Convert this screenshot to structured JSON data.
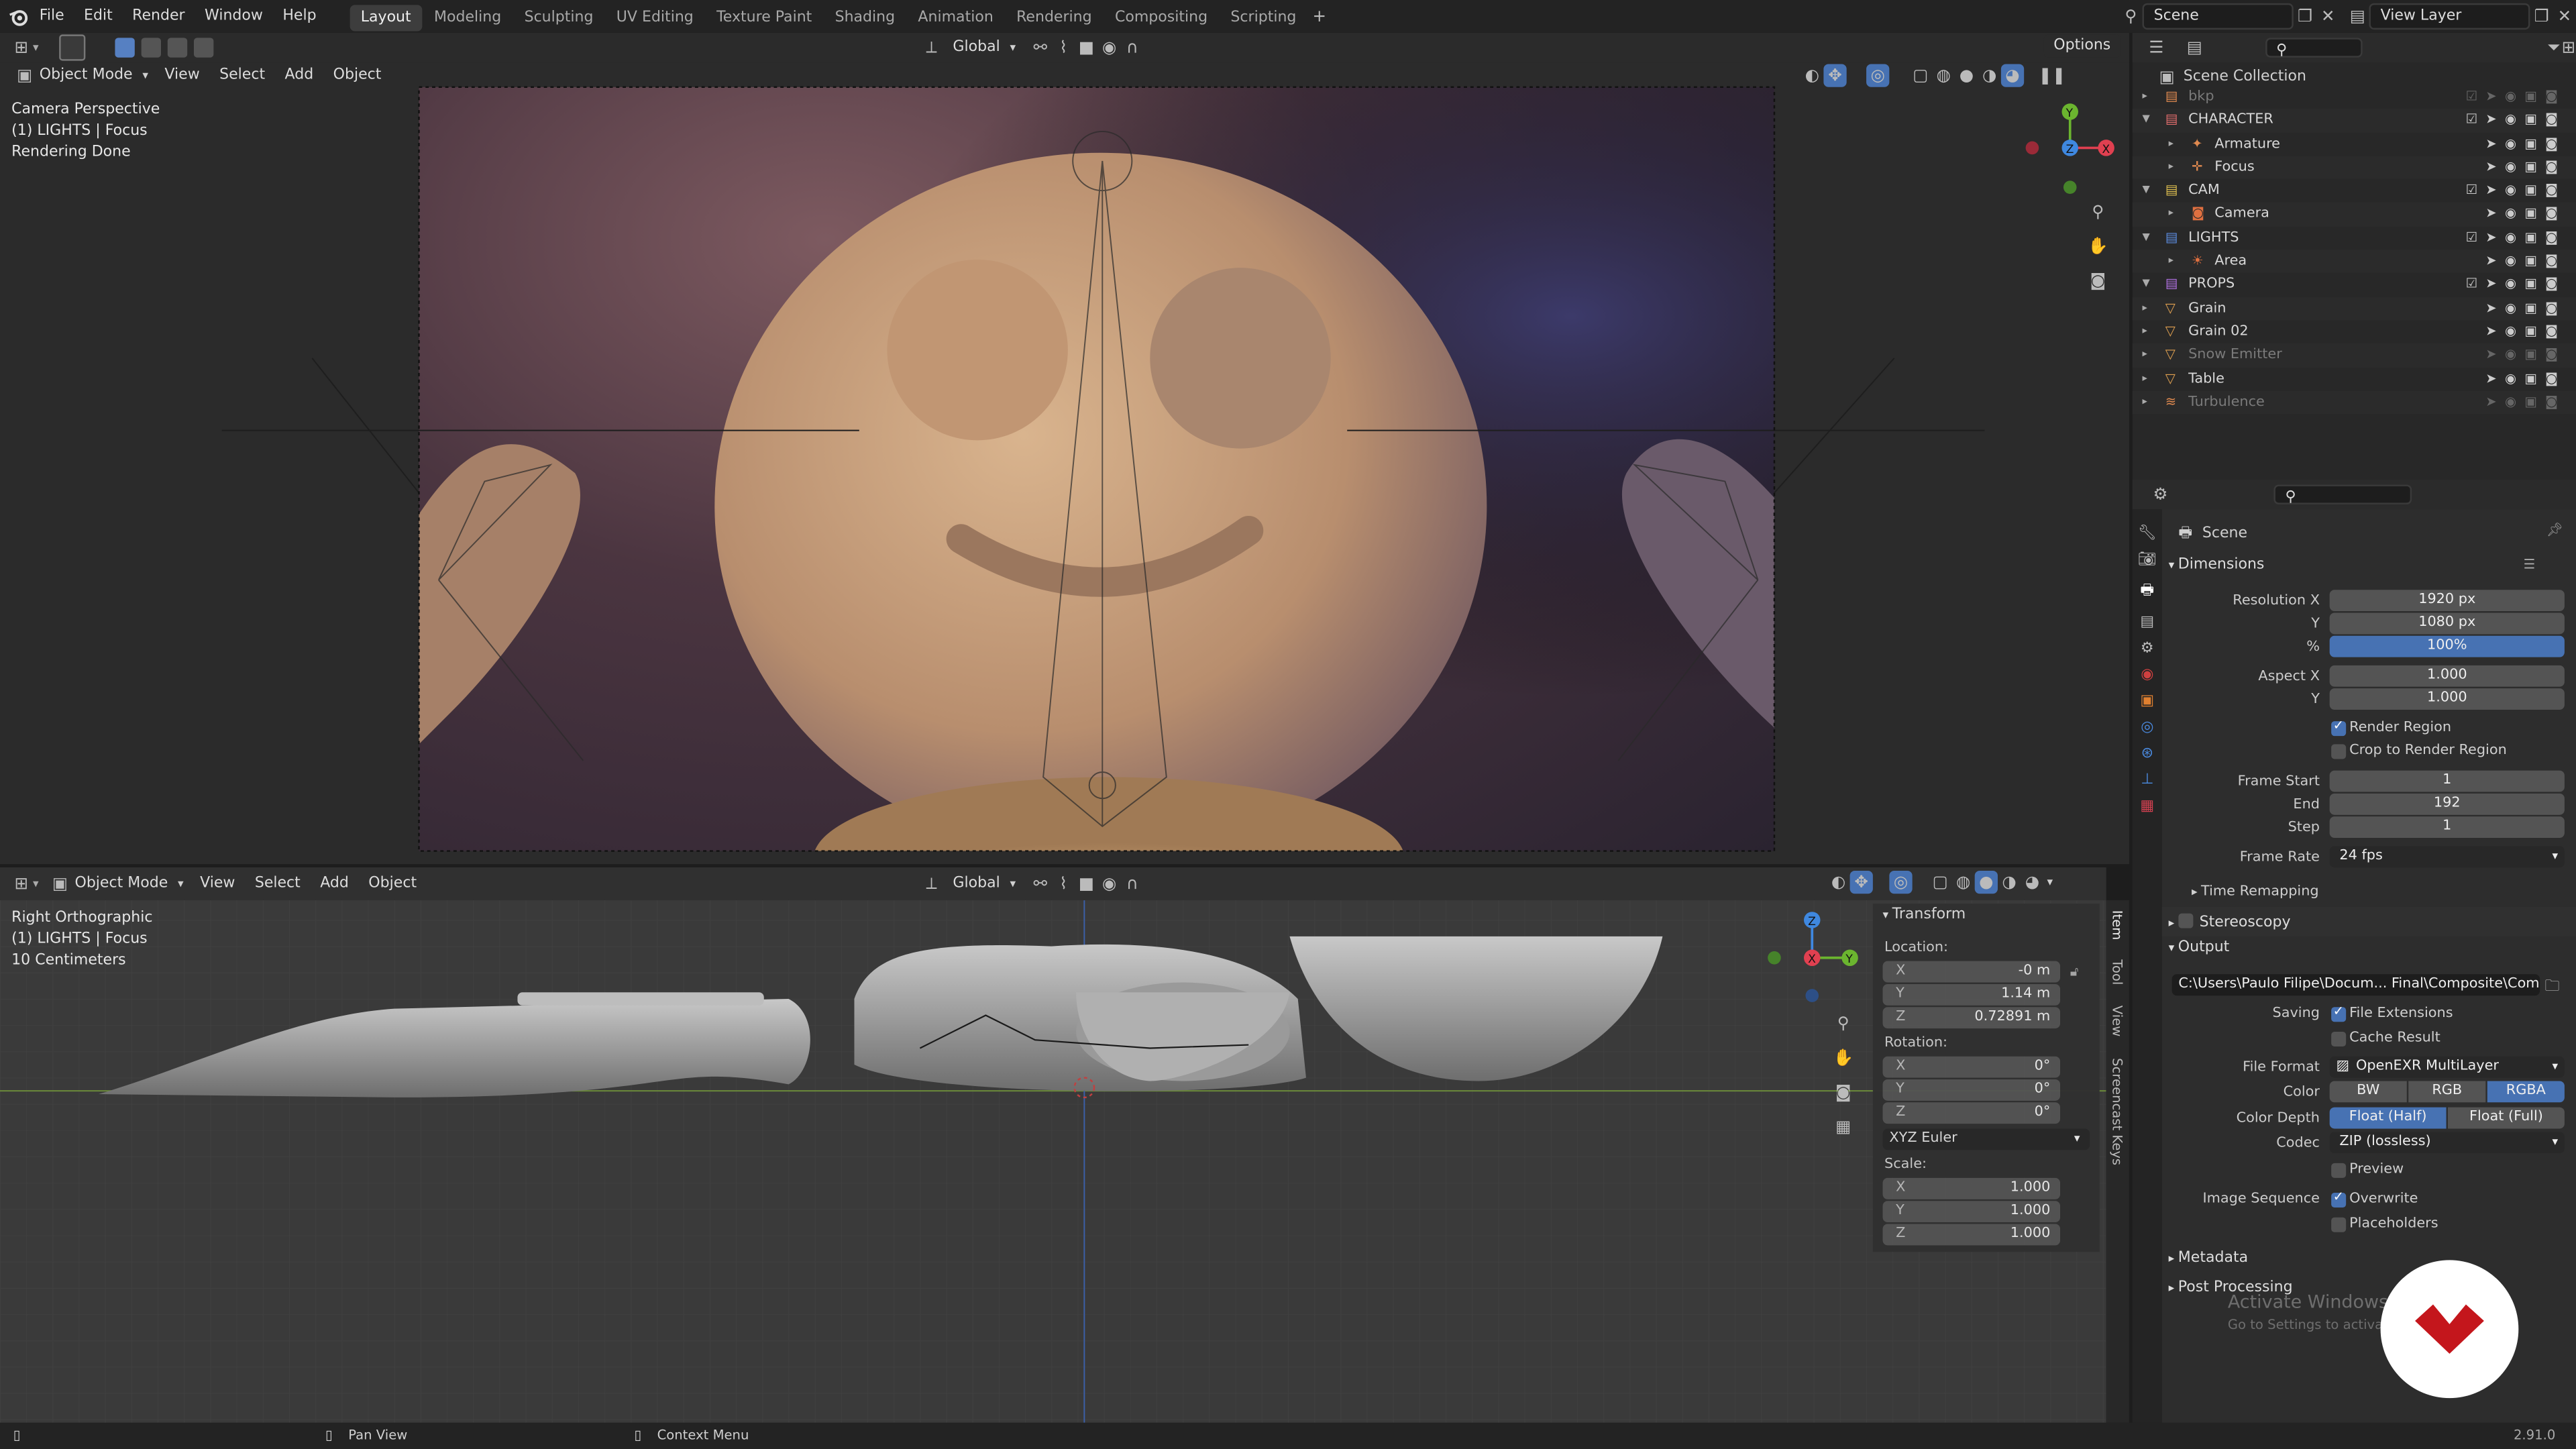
{
  "topbar": {
    "menus": [
      "File",
      "Edit",
      "Render",
      "Window",
      "Help"
    ],
    "workspaces": [
      "Layout",
      "Modeling",
      "Sculpting",
      "UV Editing",
      "Texture Paint",
      "Shading",
      "Animation",
      "Rendering",
      "Compositing",
      "Scripting"
    ],
    "active_workspace": "Layout",
    "scene": "Scene",
    "view_layer": "View Layer"
  },
  "viewport_top": {
    "mode": "Object Mode",
    "menus": [
      "View",
      "Select",
      "Add",
      "Object"
    ],
    "orientation": "Global",
    "options": "Options",
    "overlay_lines": [
      "Camera Perspective",
      "(1) LIGHTS | Focus",
      "Rendering Done"
    ]
  },
  "viewport_bottom": {
    "mode": "Object Mode",
    "menus": [
      "View",
      "Select",
      "Add",
      "Object"
    ],
    "orientation": "Global",
    "overlay_lines": [
      "Right Orthographic",
      "(1) LIGHTS | Focus",
      "10 Centimeters"
    ]
  },
  "npanel": {
    "title": "Transform",
    "location_label": "Location:",
    "location": [
      {
        "axis": "X",
        "value": "-0 m"
      },
      {
        "axis": "Y",
        "value": "1.14 m"
      },
      {
        "axis": "Z",
        "value": "0.72891 m"
      }
    ],
    "rotation_label": "Rotation:",
    "rotation": [
      {
        "axis": "X",
        "value": "0°"
      },
      {
        "axis": "Y",
        "value": "0°"
      },
      {
        "axis": "Z",
        "value": "0°"
      }
    ],
    "rotation_mode": "XYZ Euler",
    "scale_label": "Scale:",
    "scale": [
      {
        "axis": "X",
        "value": "1.000"
      },
      {
        "axis": "Y",
        "value": "1.000"
      },
      {
        "axis": "Z",
        "value": "1.000"
      }
    ],
    "tabs": [
      "Item",
      "Tool",
      "View",
      "Screencast Keys"
    ]
  },
  "outliner": {
    "title": "Scene Collection",
    "rows": [
      {
        "name": "bkp",
        "type": "collection",
        "dim": true
      },
      {
        "name": "CHARACTER",
        "type": "collection",
        "color": "#e06c6c"
      },
      {
        "name": "Armature",
        "type": "armature",
        "child": true
      },
      {
        "name": "Focus",
        "type": "empty",
        "child": true
      },
      {
        "name": "CAM",
        "type": "collection",
        "color": "#e0c050"
      },
      {
        "name": "Camera",
        "type": "camera",
        "child": true
      },
      {
        "name": "LIGHTS",
        "type": "collection",
        "color": "#5c8de0"
      },
      {
        "name": "Area",
        "type": "light",
        "child": true
      },
      {
        "name": "PROPS",
        "type": "collection",
        "color": "#b070e0"
      },
      {
        "name": "Grain",
        "type": "mesh"
      },
      {
        "name": "Grain 02",
        "type": "mesh"
      },
      {
        "name": "Snow Emitter",
        "type": "mesh",
        "dim": true
      },
      {
        "name": "Table",
        "type": "mesh"
      },
      {
        "name": "Turbulence",
        "type": "force",
        "dim": true
      }
    ]
  },
  "properties": {
    "context": "Scene",
    "dimensions": {
      "title": "Dimensions",
      "resolution_x_label": "Resolution X",
      "resolution_x": "1920 px",
      "y_label": "Y",
      "resolution_y": "1080 px",
      "pct_label": "%",
      "percentage": "100%",
      "aspect_x_label": "Aspect X",
      "aspect_x": "1.000",
      "aspect_y_label": "Y",
      "aspect_y": "1.000",
      "render_region": "Render Region",
      "crop": "Crop to Render Region",
      "frame_start_label": "Frame Start",
      "frame_start": "1",
      "end_label": "End",
      "frame_end": "192",
      "step_label": "Step",
      "frame_step": "1",
      "frame_rate_label": "Frame Rate",
      "frame_rate": "24 fps",
      "time_remapping": "Time Remapping"
    },
    "stereoscopy": "Stereoscopy",
    "output": {
      "title": "Output",
      "path": "C:\\Users\\Paulo Filipe\\Docum... Final\\Composite\\Composite",
      "saving_label": "Saving",
      "file_extensions": "File Extensions",
      "cache_result": "Cache Result",
      "file_format_label": "File Format",
      "file_format": "OpenEXR MultiLayer",
      "color_label": "Color",
      "color_options": [
        "BW",
        "RGB",
        "RGBA"
      ],
      "color_selected": "RGBA",
      "depth_label": "Color Depth",
      "depth_options": [
        "Float (Half)",
        "Float (Full)"
      ],
      "depth_selected": "Float (Half)",
      "codec_label": "Codec",
      "codec": "ZIP (lossless)",
      "preview": "Preview",
      "image_sequence_label": "Image Sequence",
      "overwrite": "Overwrite",
      "placeholders": "Placeholders"
    },
    "metadata": "Metadata",
    "post_processing": "Post Processing"
  },
  "watermark": {
    "line1": "Activate Windows",
    "line2": "Go to Settings to activate Windows."
  },
  "statusbar": {
    "pan": "Pan View",
    "context": "Context Menu",
    "version": "2.91.0"
  }
}
